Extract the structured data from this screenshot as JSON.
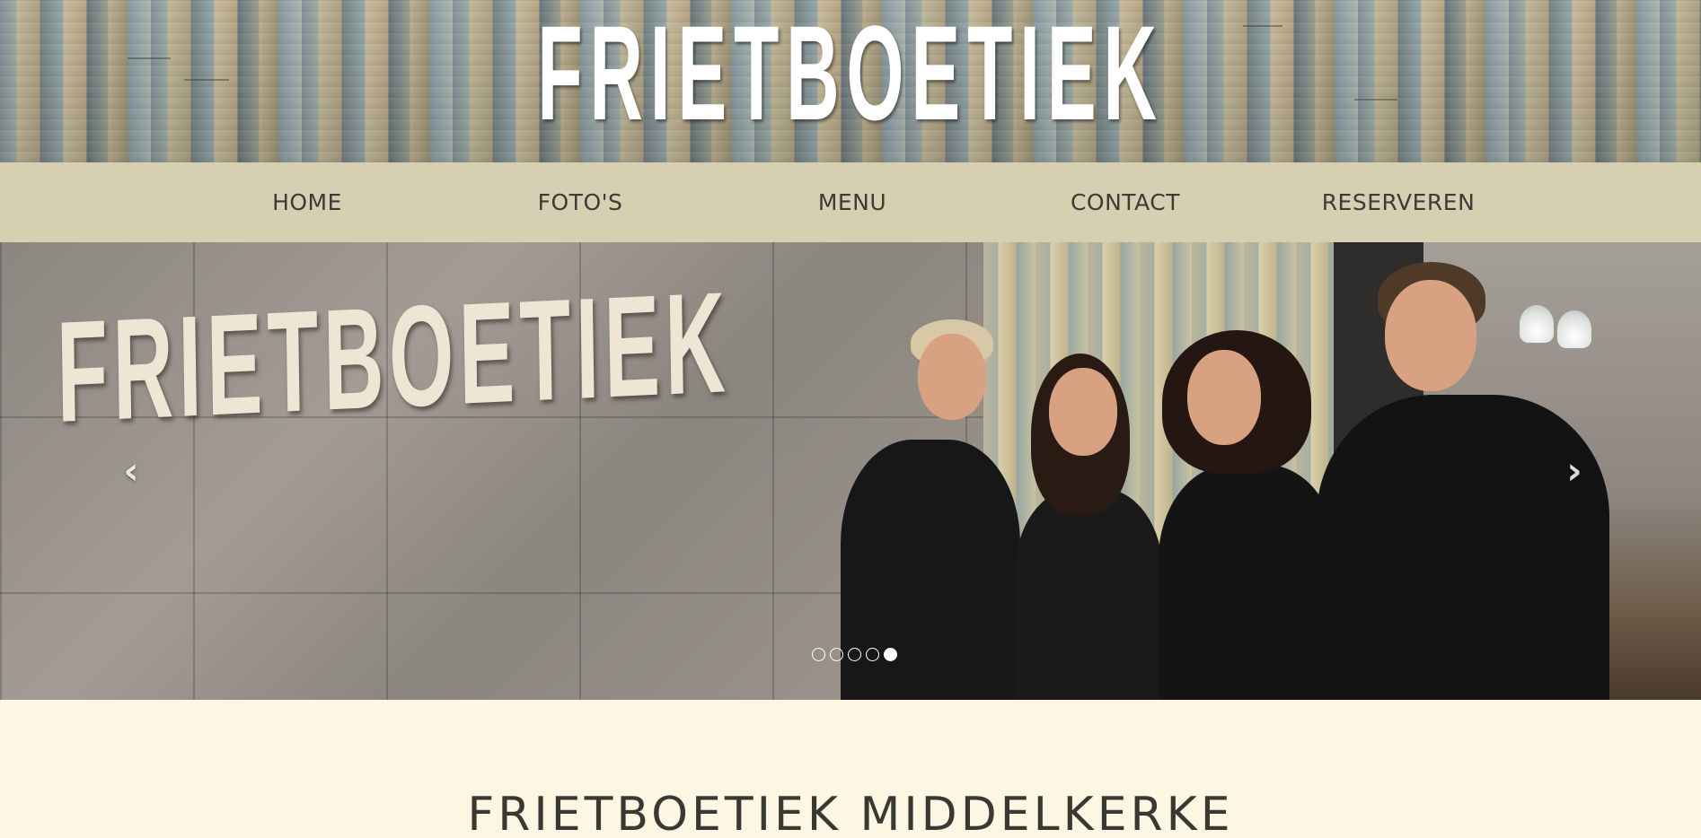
{
  "header": {
    "logo_text": "FRIETBOETIEK"
  },
  "nav": {
    "items": [
      {
        "label": "HOME"
      },
      {
        "label": "FOTO'S"
      },
      {
        "label": "MENU"
      },
      {
        "label": "CONTACT"
      },
      {
        "label": "RESERVEREN"
      }
    ]
  },
  "carousel": {
    "wall_sign_text": "FRIETBOETIEK",
    "prev_icon": "chevron-left-icon",
    "next_icon": "chevron-right-icon",
    "prev_glyph": "‹",
    "next_glyph": "›",
    "slide_count": 5,
    "active_slide": 5
  },
  "content": {
    "title": "FRIETBOETIEK MIDDELKERKE"
  },
  "colors": {
    "nav_background": "#d6cfb2",
    "page_background": "#fdf6e3",
    "text": "#3d3b35"
  }
}
